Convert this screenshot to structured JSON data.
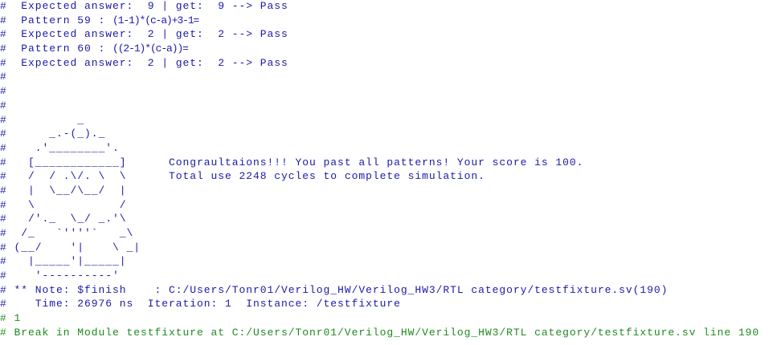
{
  "colors": {
    "background": "#ffffff",
    "message_text": "#1a1aa8",
    "break_text": "#1e8a1e"
  },
  "transcript": {
    "pattern_log": [
      {
        "text": "#  Expected answer:  9 | get:  9 --> Pass"
      },
      {
        "text": "#  Pattern 59 : ",
        "expression": "(1-1)*(c-a)+3-1="
      },
      {
        "text": "#  Expected answer:  2 | get:  2 --> Pass"
      },
      {
        "text": "#  Pattern 60 : ",
        "expression": "((2-1)*(c-a))="
      },
      {
        "text": "#  Expected answer:  2 | get:  2 --> Pass"
      }
    ],
    "spacer_lines": [
      "#",
      "#",
      "#"
    ],
    "pass_banner": {
      "art_rows": [
        "#          _",
        "#      _.-(_)._",
        "#    .'________'.",
        "#   [____________]",
        "#   /  / .\\/. \\  \\",
        "#   |  \\__/\\__/  |",
        "#   \\            /",
        "#   /'._  \\_/ _.'\\",
        "#  /_   `''''`   _\\",
        "# (__/    '|    \\ _|",
        "#   |_____'|_____|",
        "#    '----------'"
      ],
      "congrats": "Congraultaions!!! You past all patterns! Your score is 100.",
      "total_cycles": "Total use 2248 cycles to complete simulation."
    },
    "finish_note": {
      "note": "# ** Note: $finish    : C:/Users/Tonr01/Verilog_HW/Verilog_HW3/RTL category/testfixture.sv(190)",
      "time": "#    Time: 26976 ns  Iteration: 1  Instance: /testfixture"
    },
    "break_notice": {
      "status": "# 1",
      "message": "# Break in Module testfixture at C:/Users/Tonr01/Verilog_HW/Verilog_HW3/RTL category/testfixture.sv line 190"
    }
  }
}
